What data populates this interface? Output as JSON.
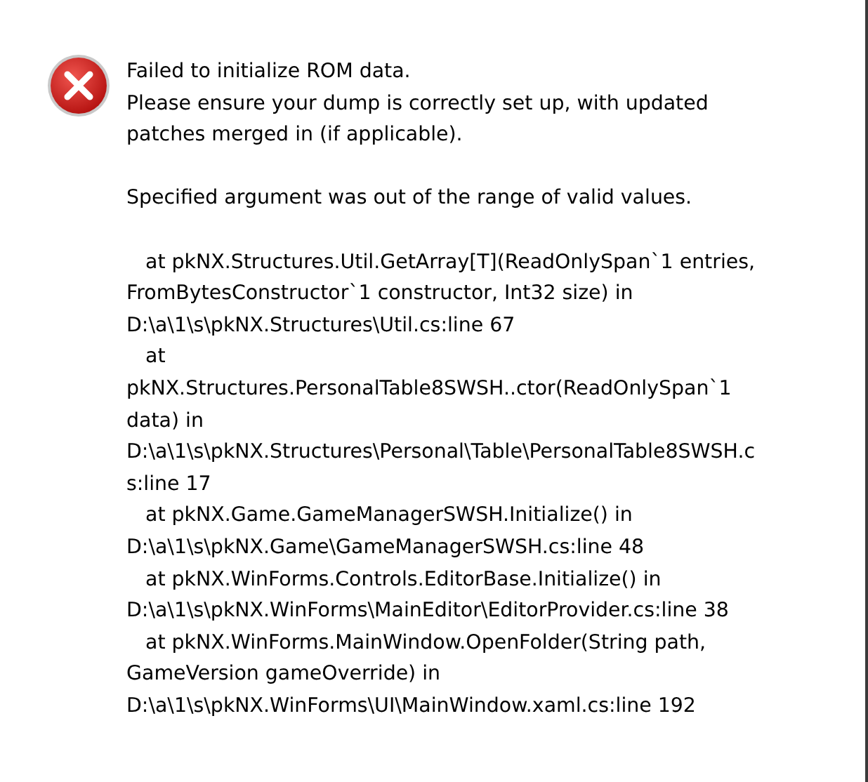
{
  "dialog": {
    "kind": "error",
    "paragraphs": [
      [
        "Failed to initialize ROM data.",
        "Please ensure your dump is correctly set up, with updated",
        "patches merged in (if applicable)."
      ],
      [
        "Specified argument was out of the range of valid values."
      ],
      [
        "   at pkNX.Structures.Util.GetArray[T](ReadOnlySpan`1 entries,",
        "FromBytesConstructor`1 constructor, Int32 size) in",
        "D:\\a\\1\\s\\pkNX.Structures\\Util.cs:line 67",
        "   at",
        "pkNX.Structures.PersonalTable8SWSH..ctor(ReadOnlySpan`1",
        "data) in",
        "D:\\a\\1\\s\\pkNX.Structures\\Personal\\Table\\PersonalTable8SWSH.c",
        "s:line 17",
        "   at pkNX.Game.GameManagerSWSH.Initialize() in",
        "D:\\a\\1\\s\\pkNX.Game\\GameManagerSWSH.cs:line 48",
        "   at pkNX.WinForms.Controls.EditorBase.Initialize() in",
        "D:\\a\\1\\s\\pkNX.WinForms\\MainEditor\\EditorProvider.cs:line 38",
        "   at pkNX.WinForms.MainWindow.OpenFolder(String path,",
        "GameVersion gameOverride) in",
        "D:\\a\\1\\s\\pkNX.WinForms\\UI\\MainWindow.xaml.cs:line 192"
      ]
    ]
  }
}
